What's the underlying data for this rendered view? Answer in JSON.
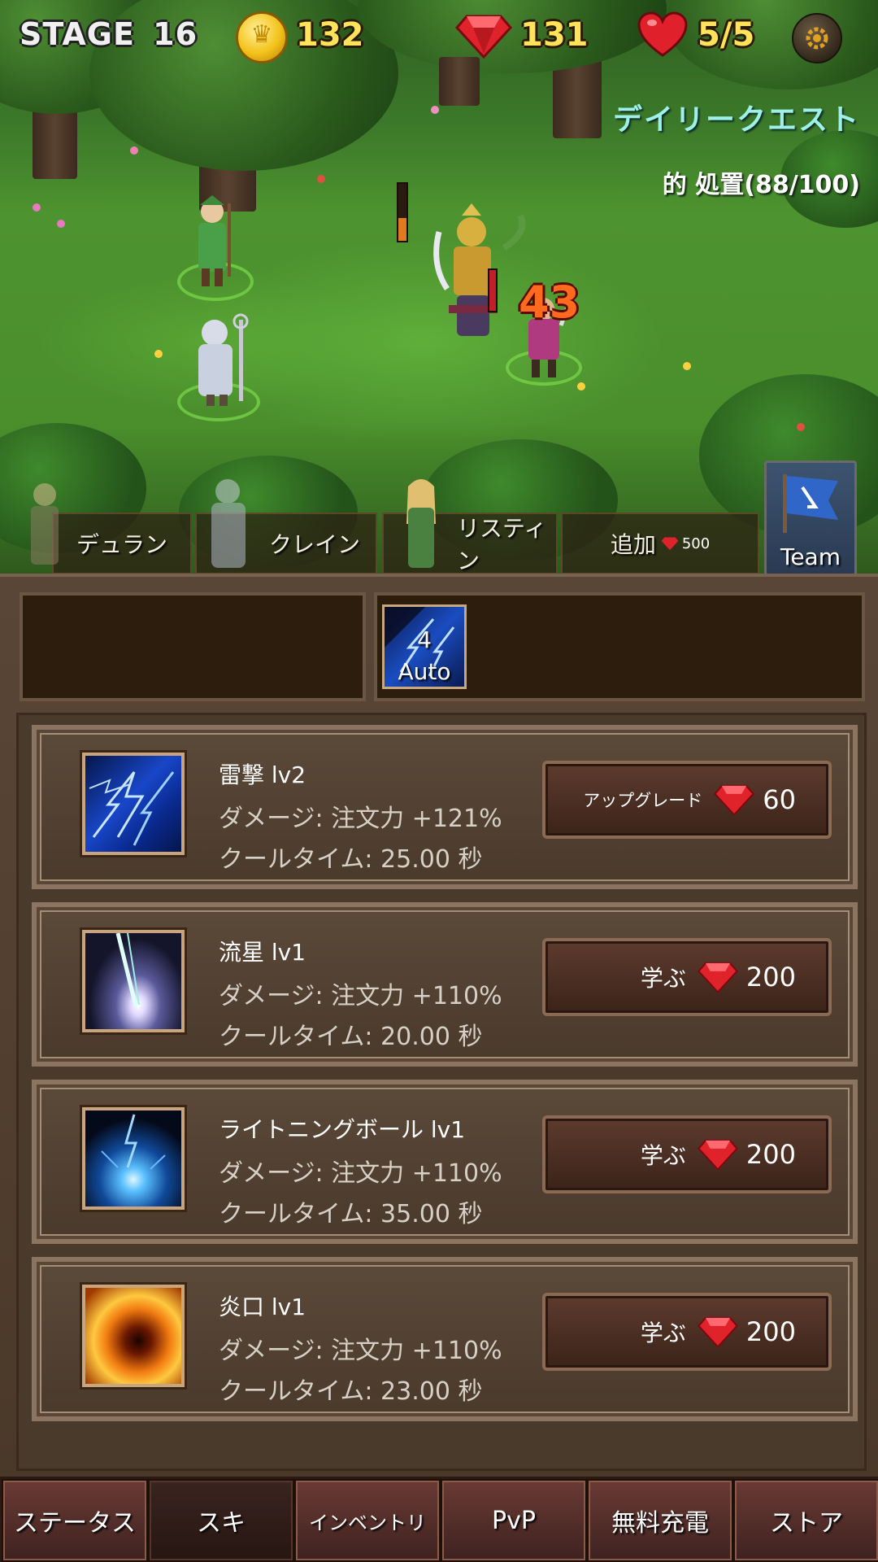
{
  "hud": {
    "stage_label": "STAGE",
    "stage_number": "16",
    "coins": "132",
    "gems": "131",
    "hearts": "5/5",
    "icons": [
      "coin-icon",
      "gem-icon",
      "heart-icon",
      "gear-icon"
    ]
  },
  "quest": {
    "title": "デイリークエスト",
    "progress": "的 処置(88/100)"
  },
  "battle": {
    "damage_number": "43"
  },
  "party": {
    "members": [
      "デュラン",
      "クレイン",
      "リスティン"
    ],
    "add_label": "追加",
    "add_cost": "500",
    "team_label": "Team"
  },
  "equipped": {
    "auto_cooldown": "4",
    "auto_label": "Auto"
  },
  "skills": [
    {
      "name": "雷撃 lv2",
      "damage": "ダメージ: 注文力 +121%",
      "cooldown": "クールタイム: 25.00 秒",
      "button_label": "アップグレード",
      "cost": "60",
      "icon": "lightning-icon"
    },
    {
      "name": "流星 lv1",
      "damage": "ダメージ: 注文力 +110%",
      "cooldown": "クールタイム: 20.00 秒",
      "button_label": "学ぶ",
      "cost": "200",
      "icon": "meteor-icon"
    },
    {
      "name": "ライトニングボール lv1",
      "damage": "ダメージ: 注文力 +110%",
      "cooldown": "クールタイム: 35.00 秒",
      "button_label": "学ぶ",
      "cost": "200",
      "icon": "lightning-ball-icon"
    },
    {
      "name": "炎口 lv1",
      "damage": "ダメージ: 注文力 +110%",
      "cooldown": "クールタイム: 23.00 秒",
      "button_label": "学ぶ",
      "cost": "200",
      "icon": "flame-icon"
    }
  ],
  "nav": {
    "tabs": [
      "ステータス",
      "スキ",
      "インベントリ",
      "PvP",
      "無料充電",
      "ストア"
    ],
    "active_index": 1
  },
  "colors": {
    "hud_gold": "#ffe35a",
    "quest_teal": "#9ef0e8",
    "damage_orange": "#ff6a1e",
    "panel_brown": "#4a3a2c",
    "gem_red": "#e0232b"
  }
}
